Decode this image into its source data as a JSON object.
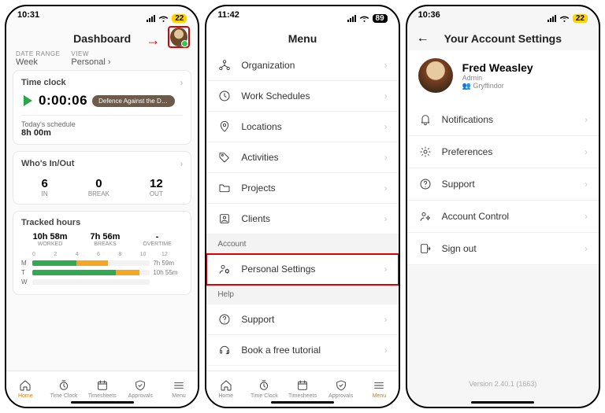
{
  "screens": {
    "dashboard": {
      "status": {
        "time": "10:31",
        "battery": "22",
        "battery_style": "y",
        "loc_icon": true
      },
      "title": "Dashboard",
      "filters": {
        "date_range_label": "DATE RANGE",
        "date_range_value": "Week",
        "view_label": "VIEW",
        "view_value": "Personal"
      },
      "time_clock": {
        "heading": "Time clock",
        "timer": "0:00:06",
        "activity_badge": "Defence Against the Dark...",
        "schedule_label": "Today's schedule",
        "schedule_value": "8h 00m"
      },
      "whos_in_out": {
        "heading": "Who's In/Out",
        "in": {
          "value": "6",
          "label": "IN"
        },
        "break": {
          "value": "0",
          "label": "BREAK"
        },
        "out": {
          "value": "12",
          "label": "OUT"
        }
      },
      "tracked": {
        "heading": "Tracked hours",
        "worked": {
          "value": "10h 58m",
          "label": "WORKED"
        },
        "breaks": {
          "value": "7h 56m",
          "label": "BREAKS"
        },
        "overtime": {
          "value": "-",
          "label": "OVERTIME"
        },
        "scale": [
          "0",
          "2",
          "4",
          "6",
          "8",
          "10",
          "12"
        ]
      },
      "tabs": [
        "Home",
        "Time Clock",
        "Timesheets",
        "Approvals",
        "Menu"
      ],
      "active_tab": 0
    },
    "menu": {
      "status": {
        "time": "11:42",
        "battery": "89",
        "battery_style": "k"
      },
      "title": "Menu",
      "groups": [
        {
          "items": [
            "Organization",
            "Work Schedules",
            "Locations",
            "Activities",
            "Projects",
            "Clients"
          ]
        },
        {
          "header": "Account",
          "items": [
            "Personal Settings"
          ]
        },
        {
          "header": "Help",
          "items": [
            "Support",
            "Book a free tutorial"
          ]
        }
      ],
      "tabs": [
        "Home",
        "Time Clock",
        "Timesheets",
        "Approvals",
        "Menu"
      ],
      "active_tab": 4
    },
    "account": {
      "status": {
        "time": "10:36",
        "battery": "22",
        "battery_style": "y"
      },
      "title": "Your Account Settings",
      "user": {
        "name": "Fred Weasley",
        "role": "Admin",
        "group": "Gryffindor"
      },
      "items": [
        "Notifications",
        "Preferences",
        "Support",
        "Account Control",
        "Sign out"
      ],
      "version": "Version 2.40.1 (1663)"
    }
  },
  "chart_data": {
    "type": "bar",
    "orientation": "horizontal-stacked",
    "unit": "hours",
    "categories": [
      "M",
      "T",
      "W"
    ],
    "series": [
      {
        "name": "Worked",
        "color": "#34a853",
        "values": [
          4.5,
          8.5,
          0
        ]
      },
      {
        "name": "Breaks",
        "color": "#f5a623",
        "values": [
          3.2,
          2.4,
          0
        ]
      }
    ],
    "row_totals": [
      "7h 59m",
      "10h 55m",
      ""
    ],
    "xlim": [
      0,
      12
    ],
    "xticks": [
      0,
      2,
      4,
      6,
      8,
      10,
      12
    ],
    "title": "Tracked hours",
    "section_totals": {
      "worked": "10h 58m",
      "breaks": "7h 56m",
      "overtime": "-"
    }
  },
  "icon_map": {
    "Organization": "org",
    "Work Schedules": "sched",
    "Locations": "loc",
    "Activities": "tag",
    "Projects": "folder",
    "Clients": "clients",
    "Personal Settings": "person-gear",
    "Support": "support",
    "Book a free tutorial": "headset",
    "Notifications": "bell",
    "Preferences": "gear",
    "Account Control": "account-ctrl",
    "Sign out": "signout"
  }
}
